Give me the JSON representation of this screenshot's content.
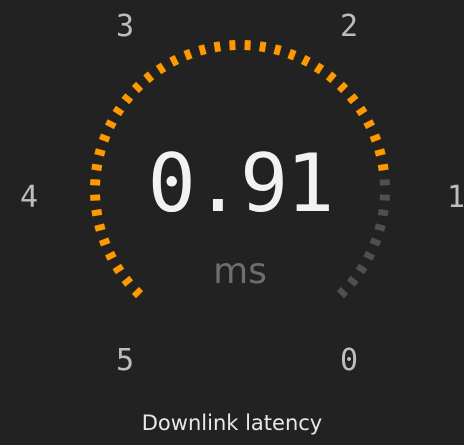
{
  "gauge": {
    "value": "0.91",
    "unit": "ms",
    "caption": "Downlink latency",
    "scale_min": 0,
    "scale_max": 5,
    "scale_labels": [
      "0",
      "1",
      "2",
      "3",
      "4",
      "5"
    ],
    "filled_fraction": 0.82,
    "colors": {
      "active": "#ff9900",
      "inactive": "#4f4f4f",
      "background": "#222222"
    }
  }
}
